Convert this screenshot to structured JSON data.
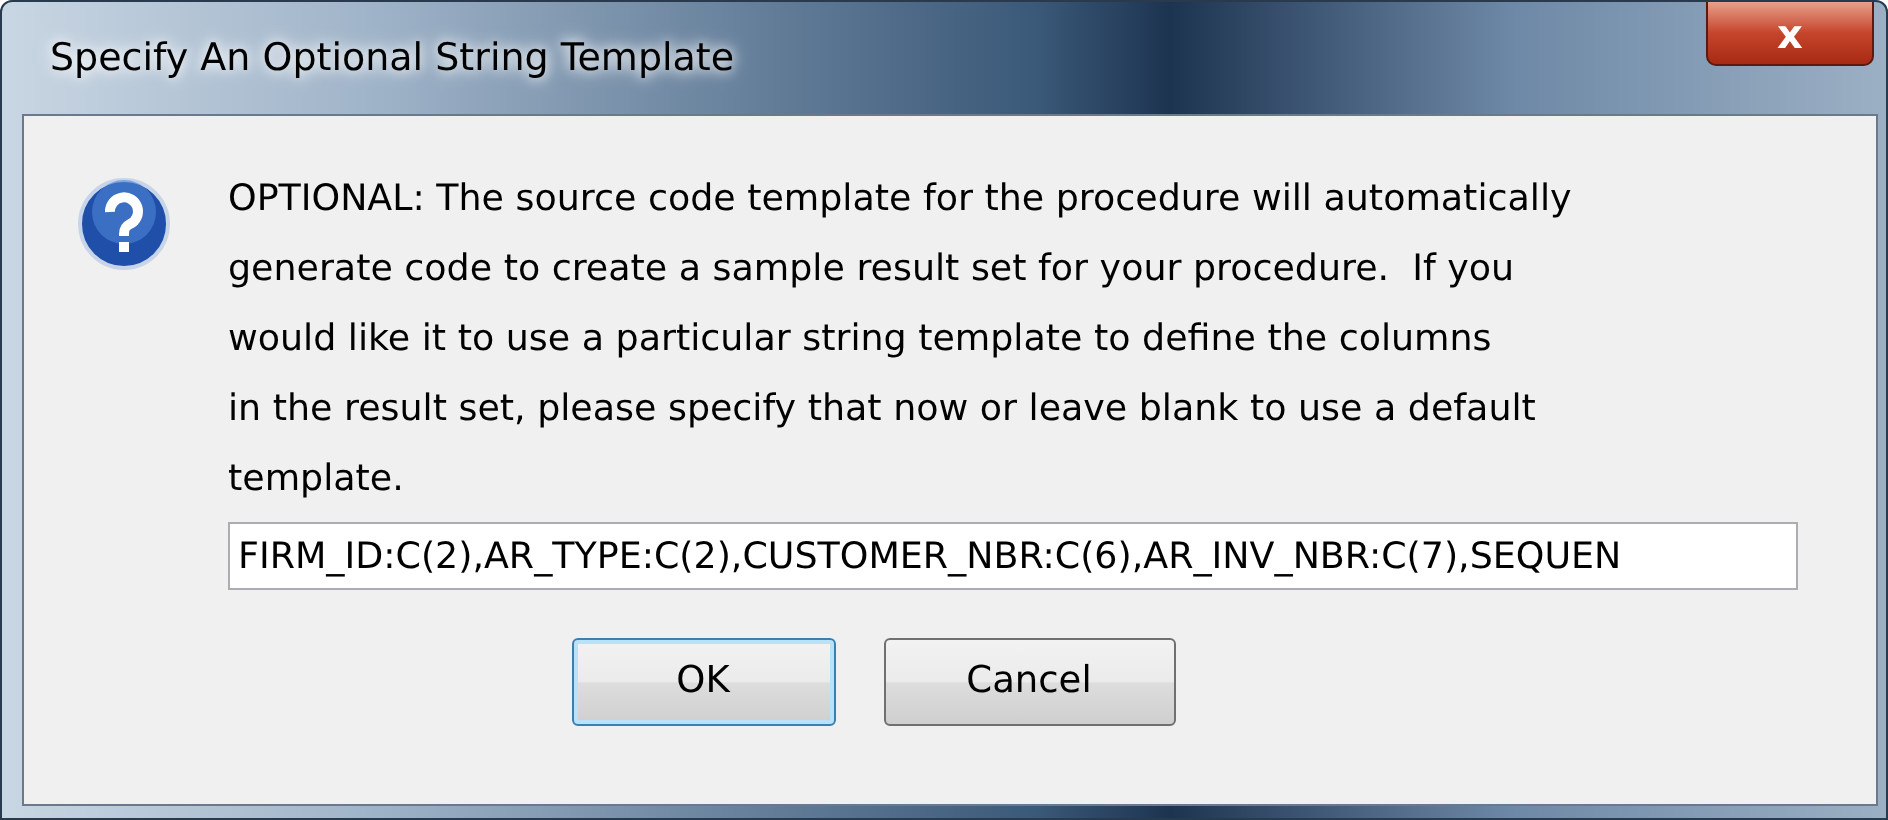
{
  "window": {
    "title": "Specify An Optional String Template",
    "close_label": "x"
  },
  "message_lines": [
    "OPTIONAL: The source code template for the procedure will automatically",
    "generate code to create a sample result set for your procedure.  If you",
    "would like it to use a particular string template to define the columns",
    "in the result set, please specify that now or leave blank to use a default",
    "template."
  ],
  "template_field": {
    "value": "FIRM_ID:C(2),AR_TYPE:C(2),CUSTOMER_NBR:C(6),AR_INV_NBR:C(7),SEQUEN"
  },
  "buttons": [
    {
      "label": "OK",
      "default": true
    },
    {
      "label": "Cancel",
      "default": false
    }
  ]
}
